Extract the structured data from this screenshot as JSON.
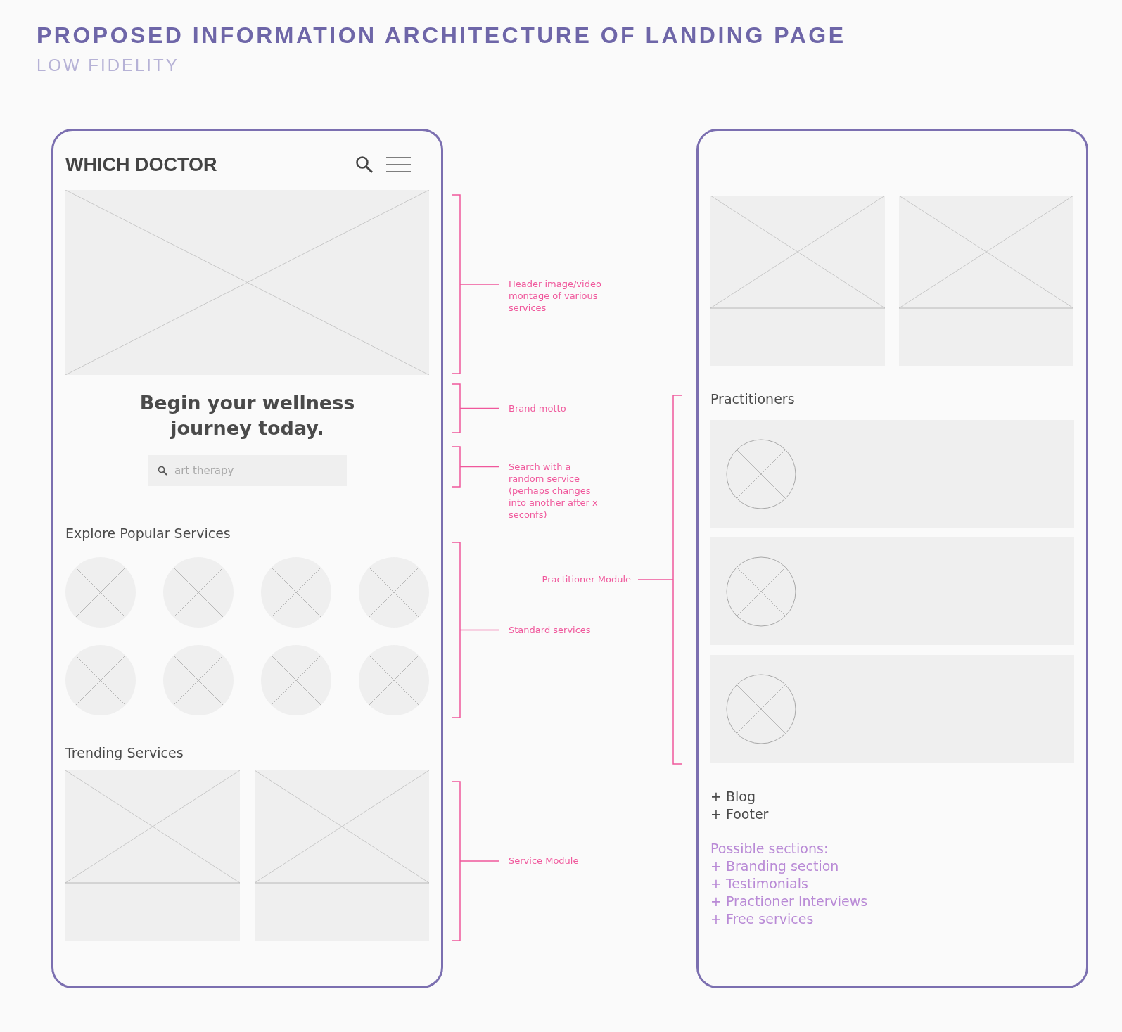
{
  "title": "PROPOSED INFORMATION ARCHITECTURE OF LANDING PAGE",
  "subtitle": "LOW FIDELITY",
  "mobile": {
    "logo": "WHICH DOCTOR",
    "hero": {
      "kind": "placeholder"
    },
    "motto": "Begin your wellness journey today.",
    "search": {
      "placeholder": "art therapy"
    },
    "popular": {
      "heading": "Explore Popular Services",
      "items": [
        {
          "kind": "placeholder"
        },
        {
          "kind": "placeholder"
        },
        {
          "kind": "placeholder"
        },
        {
          "kind": "placeholder"
        },
        {
          "kind": "placeholder"
        },
        {
          "kind": "placeholder"
        },
        {
          "kind": "placeholder"
        },
        {
          "kind": "placeholder"
        }
      ]
    },
    "trending": {
      "heading": "Trending Services",
      "cards": [
        {
          "kind": "placeholder"
        },
        {
          "kind": "placeholder"
        }
      ]
    }
  },
  "annotations": [
    {
      "text": "Header image/video montage of various services"
    },
    {
      "text": "Brand motto"
    },
    {
      "text": "Search with a random service (perhaps changes into another after x seconfs)"
    },
    {
      "text": "Practitioner Module"
    },
    {
      "text": "Standard services"
    },
    {
      "text": "Service Module"
    }
  ],
  "continuation": {
    "cards": [
      {
        "kind": "placeholder"
      },
      {
        "kind": "placeholder"
      }
    ],
    "practitioners": {
      "heading": "Practitioners",
      "rows": [
        {
          "kind": "placeholder"
        },
        {
          "kind": "placeholder"
        },
        {
          "kind": "placeholder"
        }
      ]
    },
    "extras": [
      "+ Blog",
      "+ Footer"
    ],
    "possible": {
      "heading": "Possible sections:",
      "items": [
        "+ Branding section",
        "+ Testimonials",
        "+ Practioner Interviews",
        "+ Free services"
      ]
    }
  }
}
